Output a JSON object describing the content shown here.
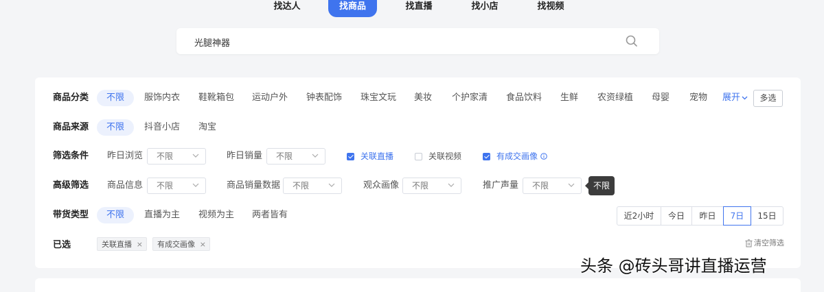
{
  "top_tabs": [
    {
      "label": "找达人",
      "active": false
    },
    {
      "label": "找商品",
      "active": true
    },
    {
      "label": "找直播",
      "active": false
    },
    {
      "label": "找小店",
      "active": false
    },
    {
      "label": "找视频",
      "active": false
    }
  ],
  "search": {
    "value": "光腿神器",
    "icon": "search-icon"
  },
  "filters": {
    "category": {
      "label": "商品分类",
      "options": [
        "不限",
        "服饰内衣",
        "鞋靴箱包",
        "运动户外",
        "钟表配饰",
        "珠宝文玩",
        "美妆",
        "个护家清",
        "食品饮料",
        "生鲜",
        "农资绿植",
        "母婴",
        "宠物"
      ],
      "selected": "不限",
      "expand_label": "展开",
      "multi_label": "多选"
    },
    "source": {
      "label": "商品来源",
      "options": [
        "不限",
        "抖音小店",
        "淘宝"
      ],
      "selected": "不限"
    },
    "conditions": {
      "label": "筛选条件",
      "yesterday_views": {
        "label": "昨日浏览",
        "value": "不限"
      },
      "yesterday_sales": {
        "label": "昨日销量",
        "value": "不限"
      },
      "linked_live": {
        "label": "关联直播",
        "checked": true
      },
      "linked_video": {
        "label": "关联视频",
        "checked": false
      },
      "has_portrait": {
        "label": "有成交画像",
        "checked": true
      }
    },
    "advanced": {
      "label": "高级筛选",
      "product_info": {
        "label": "商品信息",
        "value": "不限"
      },
      "sales_data": {
        "label": "商品销量数据",
        "value": "不限"
      },
      "audience": {
        "label": "观众画像",
        "value": "不限"
      },
      "promo_volume": {
        "label": "推广声量",
        "value": "不限"
      },
      "tooltip": "不限"
    },
    "sales_type": {
      "label": "带货类型",
      "options": [
        "不限",
        "直播为主",
        "视频为主",
        "两者皆有"
      ],
      "selected": "不限"
    },
    "time_range": {
      "options": [
        "近2小时",
        "今日",
        "昨日",
        "7日",
        "15日"
      ],
      "selected": "7日"
    },
    "selected": {
      "label": "已选",
      "tags": [
        "关联直播",
        "有成交画像"
      ],
      "clear_label": "清空筛选"
    }
  },
  "watermark": "头条 @砖头哥讲直播运营",
  "colors": {
    "accent": "#3f74ee",
    "background": "#f4f5f7",
    "tooltip": "#3c3c3c"
  }
}
